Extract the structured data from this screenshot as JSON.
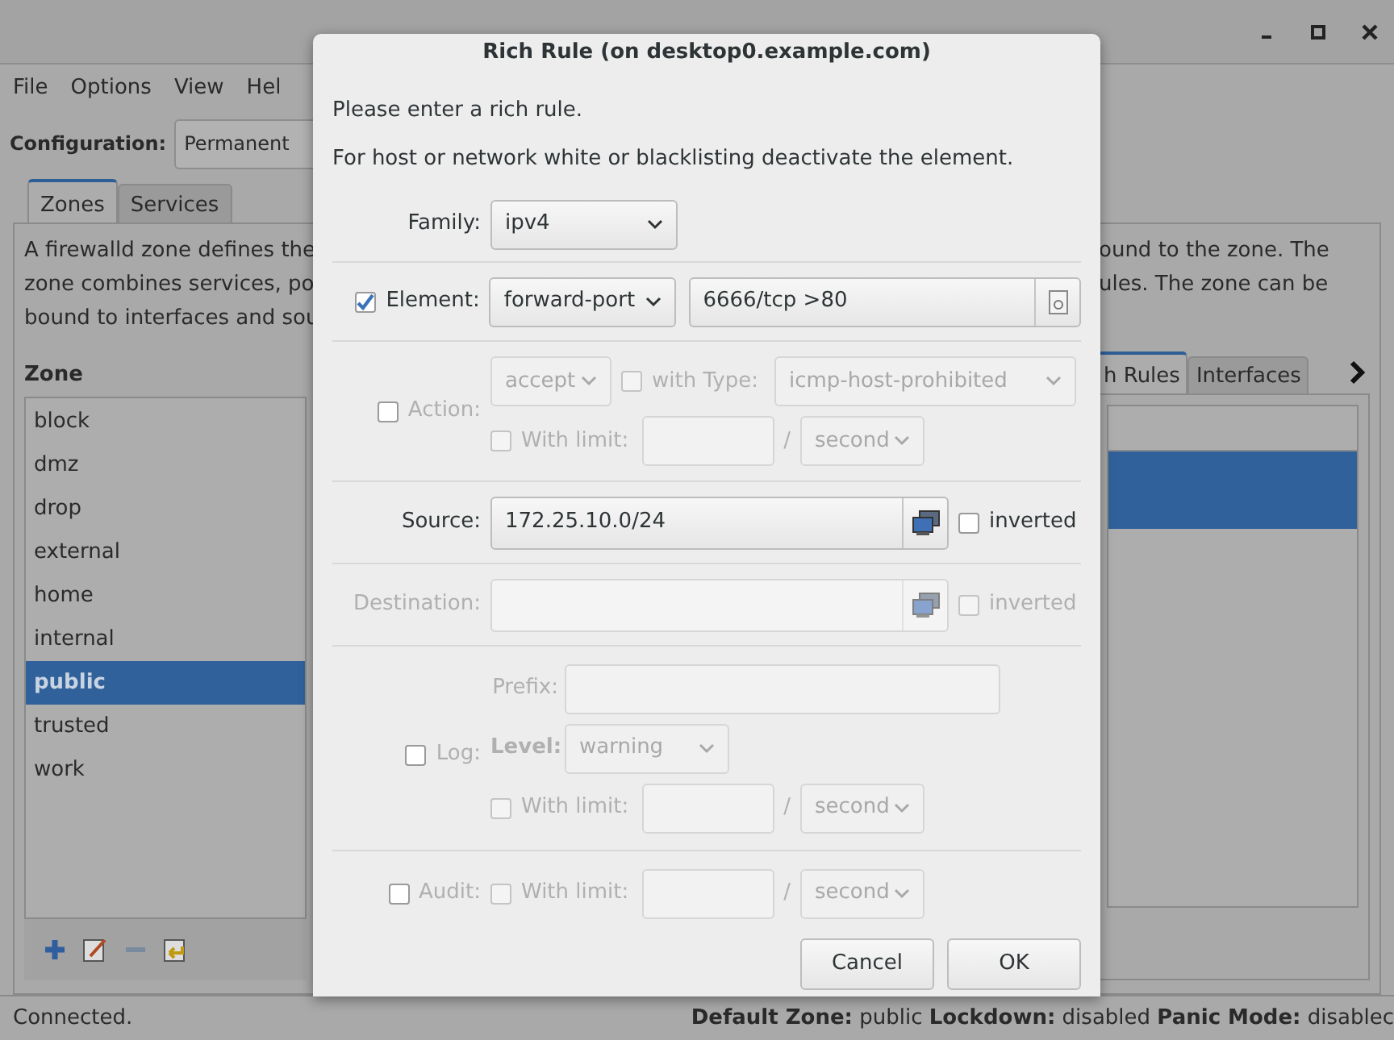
{
  "window": {
    "menu": [
      "File",
      "Options",
      "View",
      "Hel"
    ],
    "configuration": {
      "label": "Configuration:",
      "value": "Permanent"
    },
    "tabs": [
      {
        "label": "Zones",
        "selected": true
      },
      {
        "label": "Services",
        "selected": false
      }
    ],
    "description_left": [
      "A firewalld zone defines the",
      "zone combines services, po",
      "bound to interfaces and sou"
    ],
    "description_right": [
      "ound to the zone. The",
      "ules. The zone can be"
    ],
    "zone_heading": "Zone",
    "zones": [
      {
        "name": "block",
        "selected": false
      },
      {
        "name": "dmz",
        "selected": false
      },
      {
        "name": "drop",
        "selected": false
      },
      {
        "name": "external",
        "selected": false
      },
      {
        "name": "home",
        "selected": false
      },
      {
        "name": "internal",
        "selected": false
      },
      {
        "name": "public",
        "selected": true
      },
      {
        "name": "trusted",
        "selected": false
      },
      {
        "name": "work",
        "selected": false
      }
    ],
    "right_tabs": [
      {
        "label": "h Rules",
        "selected": true
      },
      {
        "label": "Interfaces",
        "selected": false
      }
    ],
    "right_rows": [
      {
        "selected": false
      },
      {
        "selected": true
      }
    ],
    "status": {
      "left": "Connected.",
      "right": "**Default Zone:** public **Lockdown:** disabled **Panic Mode:** disablec"
    }
  },
  "dialog": {
    "title": "Rich Rule (on desktop0.example.com)",
    "intro": [
      "Please enter a rich rule.",
      "For host or network white or blacklisting deactivate the element."
    ],
    "family": {
      "label": "Family:",
      "value": "ipv4"
    },
    "element": {
      "checked": true,
      "label": "Element:",
      "type": "forward-port",
      "value": "6666/tcp >80"
    },
    "action": {
      "checked": false,
      "label": "Action:",
      "value": "accept",
      "with_type": {
        "checked": false,
        "label": "with Type:",
        "value": "icmp-host-prohibited"
      },
      "limit": {
        "checked": false,
        "label": "With limit:",
        "separator": "/",
        "unit": "second"
      }
    },
    "source": {
      "disabled": false,
      "label": "Source:",
      "value": "172.25.10.0/24",
      "inverted": {
        "checked": false,
        "label": "inverted"
      }
    },
    "destination": {
      "disabled": true,
      "label": "Destination:",
      "inverted": {
        "checked": false,
        "label": "inverted"
      }
    },
    "log": {
      "checked": false,
      "label": "Log:",
      "prefix_label": "Prefix:",
      "level_label": "Level:",
      "level": "warning",
      "limit": {
        "checked": false,
        "label": "With limit:",
        "separator": "/",
        "unit": "second"
      }
    },
    "audit": {
      "checked": false,
      "label": "Audit:",
      "limit": {
        "checked": false,
        "label": "With limit:",
        "separator": "/",
        "unit": "second"
      }
    },
    "buttons": [
      "Cancel",
      "OK"
    ]
  }
}
